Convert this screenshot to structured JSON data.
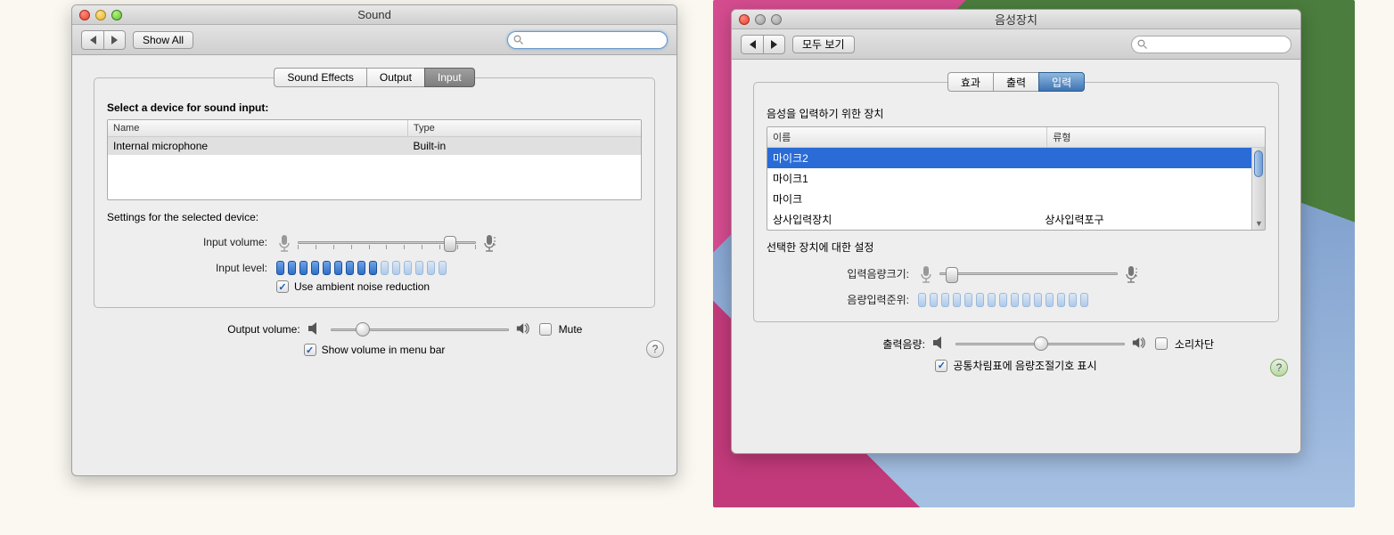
{
  "left": {
    "title": "Sound",
    "toolbar": {
      "show_all": "Show All"
    },
    "tabs": [
      "Sound Effects",
      "Output",
      "Input"
    ],
    "active_tab": 2,
    "select_device_label": "Select a device for sound input:",
    "columns": {
      "name": "Name",
      "type": "Type"
    },
    "devices": [
      {
        "name": "Internal microphone",
        "type": "Built-in",
        "selected": true
      }
    ],
    "settings_label": "Settings for the selected device:",
    "input_volume_label": "Input volume:",
    "input_volume_pos": 0.88,
    "input_level_label": "Input level:",
    "input_level_total": 15,
    "input_level_active": 9,
    "ambient_label": "Use ambient noise reduction",
    "ambient_checked": true,
    "output_volume_label": "Output volume:",
    "output_volume_pos": 0.15,
    "mute_label": "Mute",
    "mute_checked": false,
    "menu_bar_label": "Show volume in menu bar",
    "menu_bar_checked": true
  },
  "right": {
    "title": "음성장치",
    "toolbar": {
      "show_all": "모두 보기"
    },
    "tabs": [
      "효과",
      "출력",
      "입력"
    ],
    "active_tab": 2,
    "select_device_label": "음성을 입력하기 위한 장치",
    "columns": {
      "name": "이름",
      "type": "류형"
    },
    "devices": [
      {
        "name": "마이크2",
        "type": "",
        "selected": true
      },
      {
        "name": "마이크1",
        "type": ""
      },
      {
        "name": "마이크",
        "type": ""
      },
      {
        "name": "상사입력장치",
        "type": "상사입력포구"
      }
    ],
    "settings_label": "선택한 장치에 대한 설정",
    "input_volume_label": "입력음량크기:",
    "input_volume_pos": 0.04,
    "input_level_label": "음량입력준위:",
    "input_level_total": 15,
    "input_level_active": 0,
    "output_volume_label": "출력음량:",
    "output_volume_pos": 0.5,
    "mute_label": "소리차단",
    "mute_checked": false,
    "menu_bar_label": "공통차림표에 음량조절기호 표시",
    "menu_bar_checked": true
  }
}
